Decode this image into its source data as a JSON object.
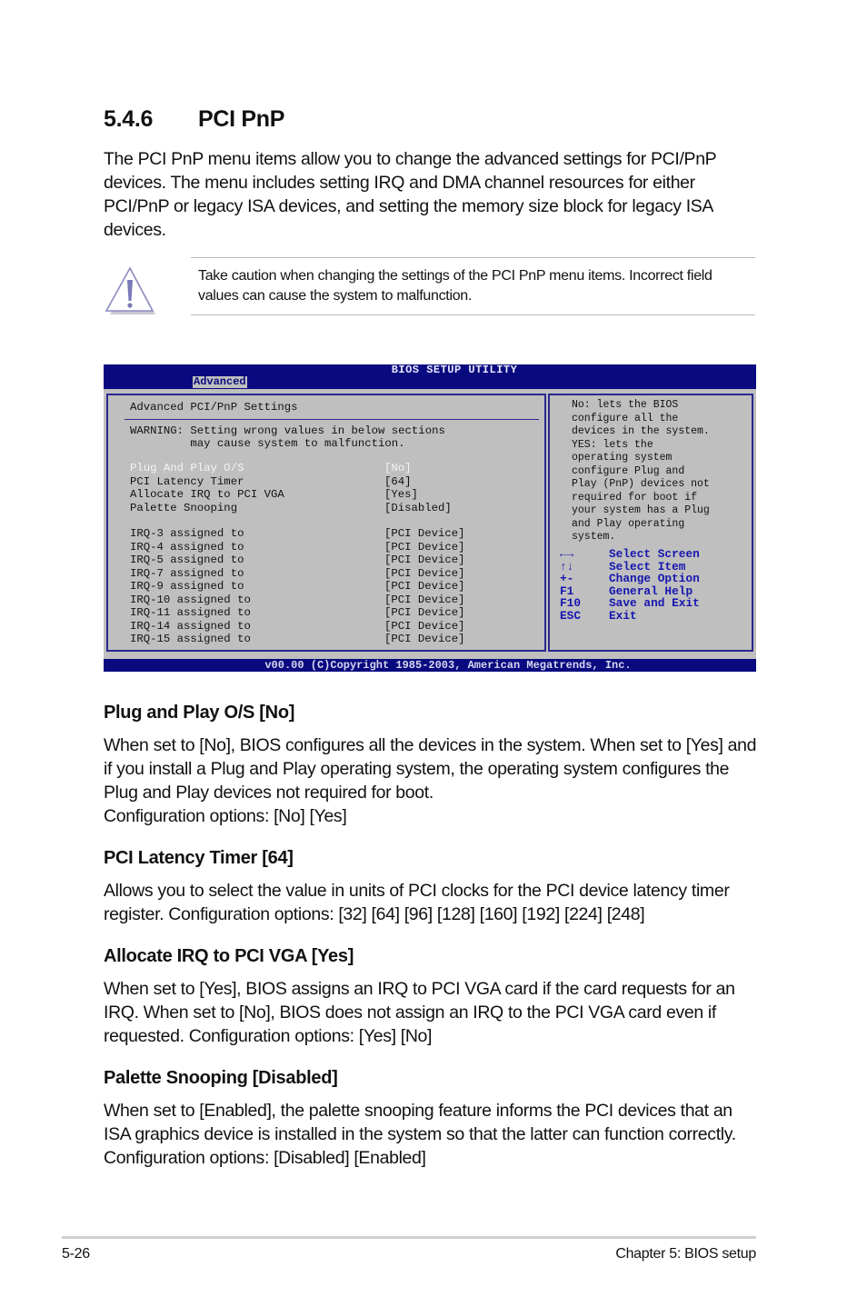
{
  "section": {
    "number": "5.4.6",
    "title": "PCI PnP",
    "intro": "The PCI PnP menu items allow you to change the advanced settings for PCI/PnP devices. The menu includes setting IRQ and DMA channel resources for either PCI/PnP or legacy ISA devices, and setting the memory size block for legacy ISA devices."
  },
  "caution": {
    "icon": "warning-triangle-icon",
    "text": "Take caution when changing the settings of the PCI PnP menu items. Incorrect field values can cause the system to malfunction."
  },
  "bios": {
    "title": "BIOS SETUP UTILITY",
    "active_tab": "Advanced",
    "panel_title": "Advanced PCI/PnP Settings",
    "warning_line1": "WARNING: Setting wrong values in below sections",
    "warning_line2": "         may cause system to malfunction.",
    "settings": [
      {
        "label": "Plug And Play O/S",
        "value": "[No]",
        "selected": true
      },
      {
        "label": "PCI Latency Timer",
        "value": "[64]"
      },
      {
        "label": "Allocate IRQ to PCI VGA",
        "value": "[Yes]"
      },
      {
        "label": "Palette Snooping",
        "value": "[Disabled]"
      }
    ],
    "irqs": [
      {
        "label": "IRQ-3 assigned to",
        "value": "[PCI Device]"
      },
      {
        "label": "IRQ-4 assigned to",
        "value": "[PCI Device]"
      },
      {
        "label": "IRQ-5 assigned to",
        "value": "[PCI Device]"
      },
      {
        "label": "IRQ-7 assigned to",
        "value": "[PCI Device]"
      },
      {
        "label": "IRQ-9 assigned to",
        "value": "[PCI Device]"
      },
      {
        "label": "IRQ-10 assigned to",
        "value": "[PCI Device]"
      },
      {
        "label": "IRQ-11 assigned to",
        "value": "[PCI Device]"
      },
      {
        "label": "IRQ-14 assigned to",
        "value": "[PCI Device]"
      },
      {
        "label": "IRQ-15 assigned to",
        "value": "[PCI Device]"
      }
    ],
    "help_lines": [
      "No: lets the BIOS",
      "configure all the",
      "devices in the system.",
      "YES: lets the",
      "operating system",
      "configure Plug and",
      "Play (PnP) devices not",
      "required for boot if",
      "your system has a Plug",
      "and Play operating",
      "system."
    ],
    "keys": [
      {
        "key": "←→",
        "action": "Select Screen"
      },
      {
        "key": "↑↓",
        "action": "Select Item"
      },
      {
        "key": "+-",
        "action": "Change Option"
      },
      {
        "key": "F1",
        "action": "General Help"
      },
      {
        "key": "F10",
        "action": "Save and Exit"
      },
      {
        "key": "ESC",
        "action": "Exit"
      }
    ],
    "copyright": "v00.00 (C)Copyright 1985-2003, American Megatrends, Inc.",
    "colors": {
      "bar": "#0a0a80",
      "panel": "#bfbfbf",
      "key_text": "#1616b0"
    }
  },
  "items": [
    {
      "heading": "Plug and Play O/S [No]",
      "body": "When set to [No], BIOS configures all the devices in the system. When set to [Yes] and if you install a Plug and Play operating system, the operating system configures the Plug and Play devices not required for boot.",
      "options": "Configuration options: [No] [Yes]"
    },
    {
      "heading": "PCI Latency Timer [64]",
      "body": "Allows you to select the value in units of PCI clocks for the PCI device latency timer register. Configuration options: [32] [64] [96] [128] [160] [192] [224] [248]"
    },
    {
      "heading": "Allocate IRQ to PCI VGA [Yes]",
      "body": "When set to [Yes], BIOS assigns an IRQ to PCI VGA card if the card requests for an IRQ. When set to [No], BIOS does not assign an IRQ to the PCI VGA card even if requested. Configuration options: [Yes] [No]"
    },
    {
      "heading": "Palette Snooping [Disabled]",
      "body": "When set to [Enabled], the palette snooping feature informs the PCI devices that an ISA graphics device is installed in the system so that the latter can function correctly. Configuration options: [Disabled] [Enabled]"
    }
  ],
  "footer": {
    "page": "5-26",
    "chapter": "Chapter 5: BIOS setup"
  }
}
